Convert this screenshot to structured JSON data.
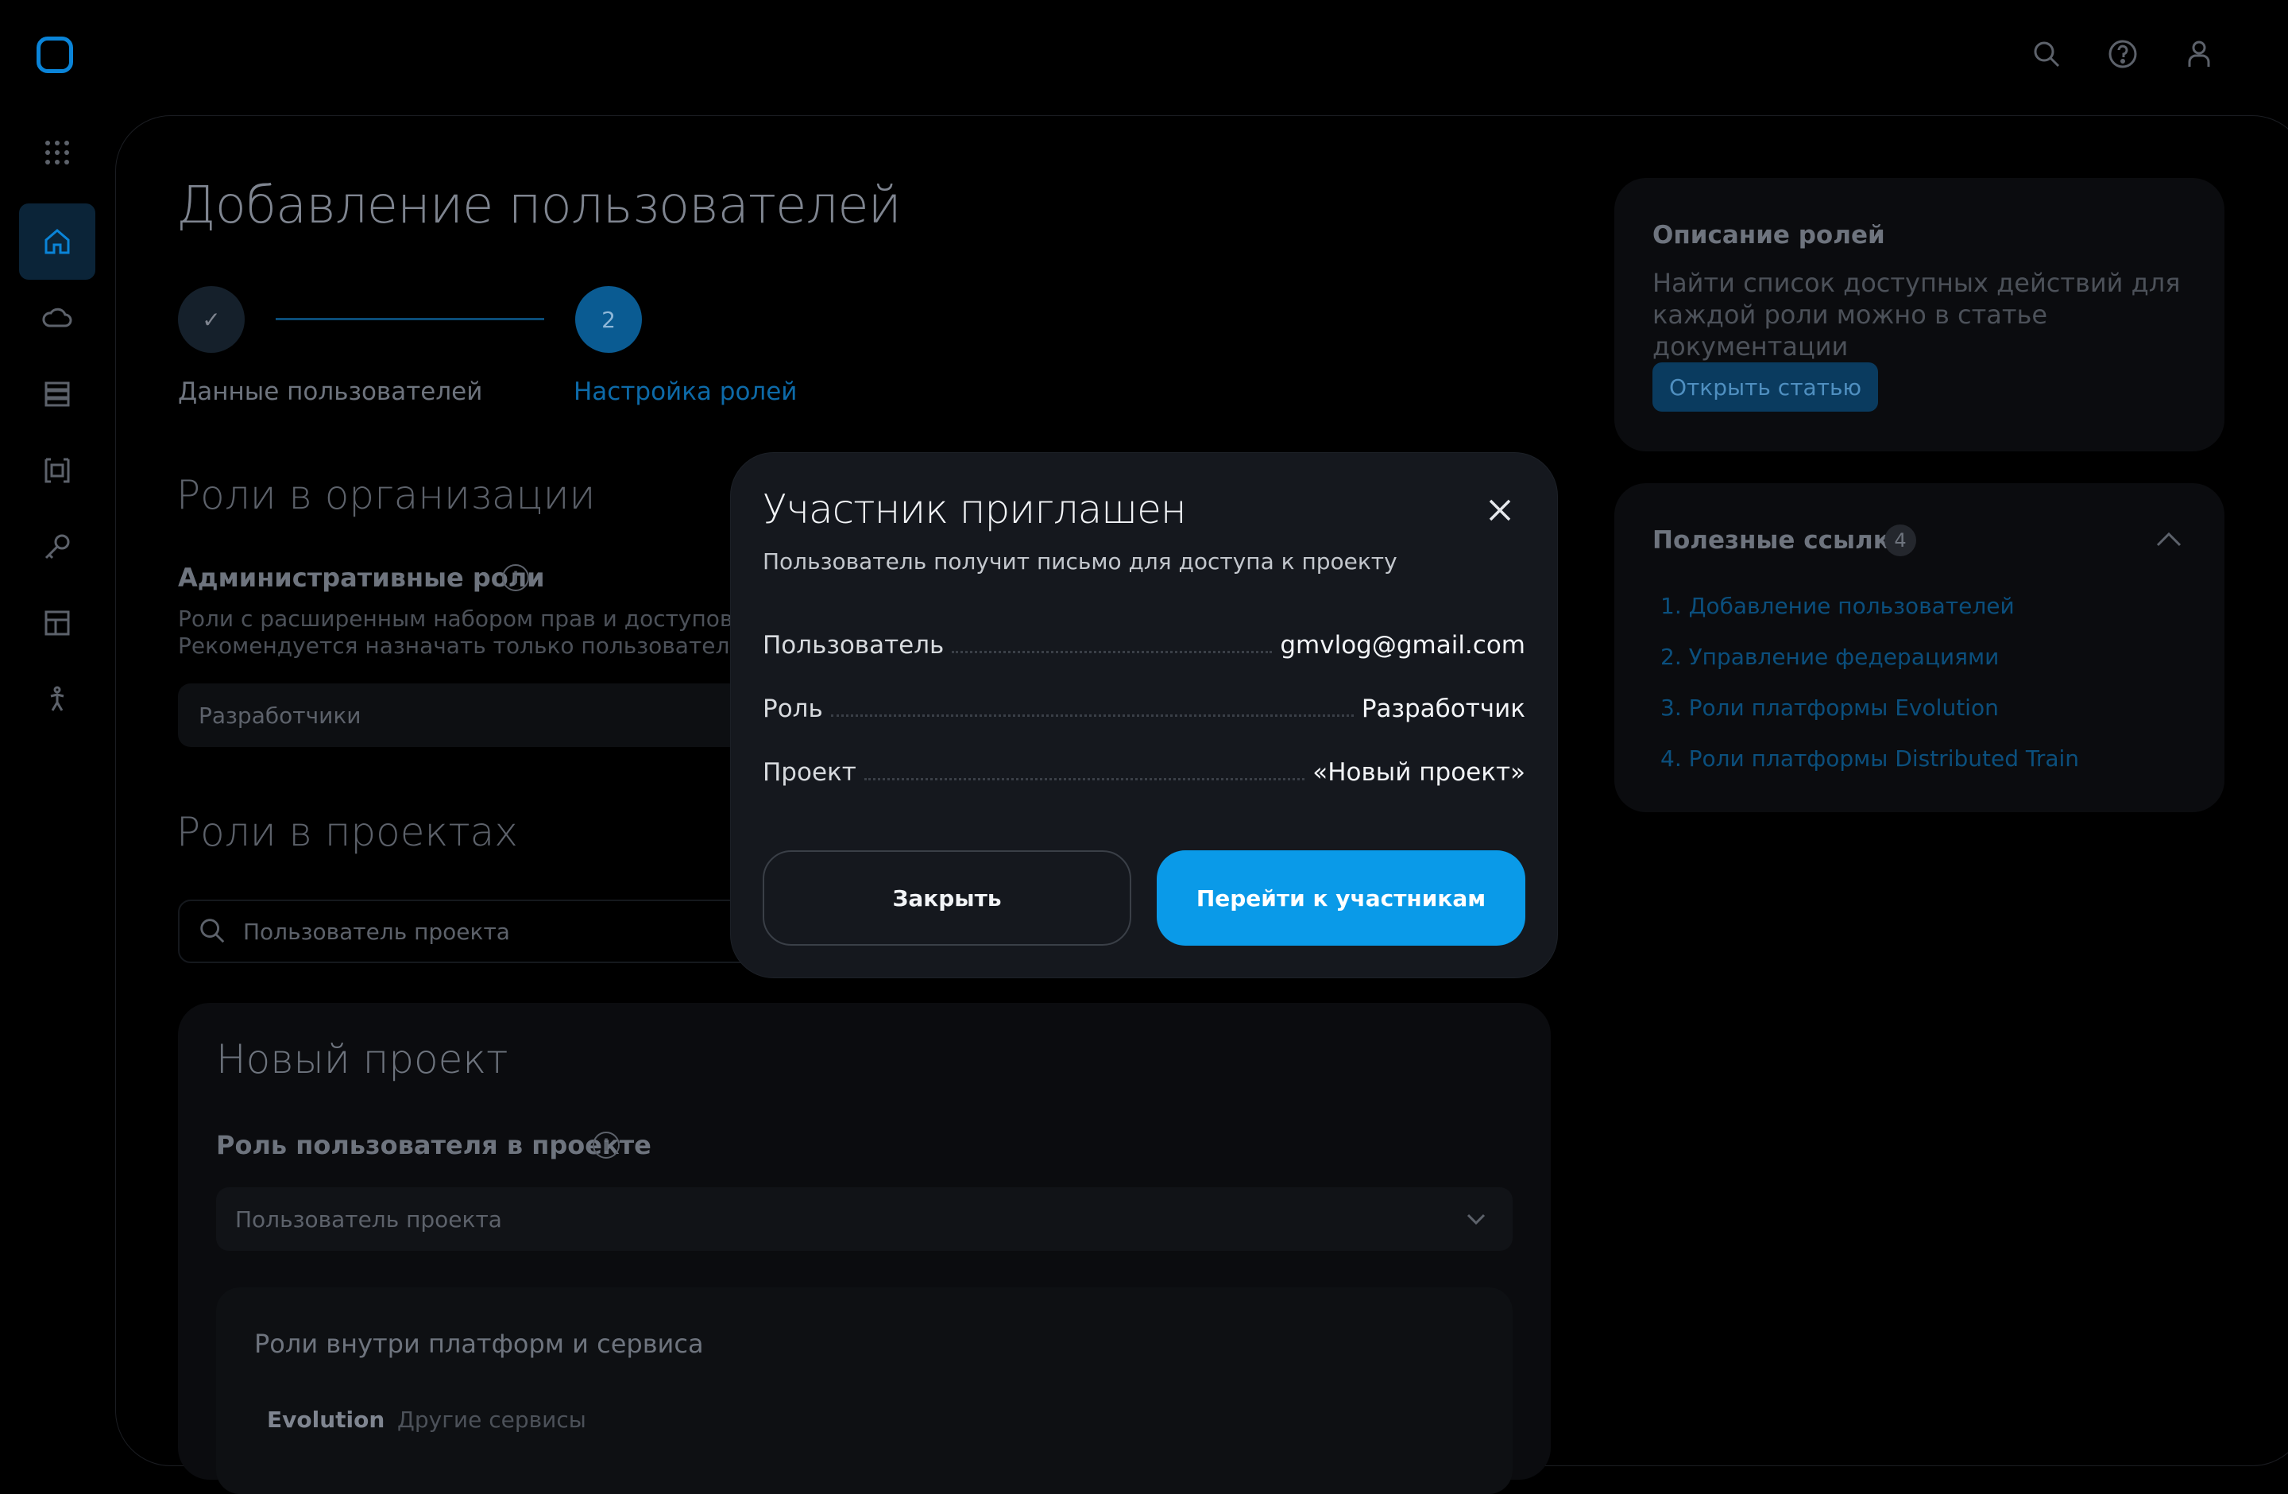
{
  "header": {
    "icons": [
      "search-icon",
      "help-icon",
      "user-icon"
    ]
  },
  "sidebar": {
    "icons": [
      "apps-grid-icon",
      "home-icon",
      "cloud-icon",
      "database-icon",
      "frame-icon",
      "key-icon",
      "layout-icon",
      "accessibility-icon"
    ]
  },
  "page": {
    "title": "Добавление пользователей",
    "steps": [
      {
        "label": "Данные пользователей",
        "marker": "✓"
      },
      {
        "label": "Настройка ролей",
        "marker": "2"
      }
    ]
  },
  "org_roles": {
    "title": "Роли в организации",
    "admin_title": "Административные роли",
    "admin_desc_1": "Роли с расширенным набором прав и доступов на",
    "admin_desc_2": "Рекомендуется назначать только пользователям, а",
    "admin_value": "Разработчики"
  },
  "project_roles": {
    "title": "Роли в проектах",
    "search_placeholder": "Пользователь проекта",
    "project_name": "Новый проект",
    "role_title": "Роль пользователя в проекте",
    "role_value": "Пользователь проекта",
    "inner_title": "Роли внутри платформ и сервиса",
    "tabs": [
      "Evolution",
      "Другие сервисы"
    ]
  },
  "roles_card": {
    "title": "Описание ролей",
    "text": "Найти список доступных действий для каждой роли можно в статье документации",
    "button": "Открыть статью"
  },
  "links_card": {
    "title": "Полезные ссылки",
    "count": "4",
    "links": [
      "1. Добавление пользователей",
      "2. Управление федерациями",
      "3. Роли платформы Evolution",
      "4. Роли платформы Distributed Train"
    ]
  },
  "modal": {
    "title": "Участник приглашен",
    "subtitle": "Пользователь получит письмо для доступа к проекту",
    "rows": [
      {
        "key": "Пользователь",
        "value": "gmvlog@gmail.com"
      },
      {
        "key": "Роль",
        "value": "Разработчик"
      },
      {
        "key": "Проект",
        "value": "«Новый проект»"
      }
    ],
    "close_button": "Закрыть",
    "primary_button": "Перейти к участникам"
  }
}
